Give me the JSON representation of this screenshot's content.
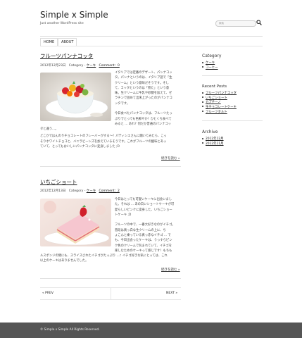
{
  "site": {
    "title": "Simple x Simple",
    "tagline": "Just another WordPress site"
  },
  "search": {
    "placeholder": "検索"
  },
  "nav": {
    "items": [
      "HOME",
      "ABOUT"
    ]
  },
  "posts": [
    {
      "title": "フルーツパンナコッタ",
      "date": "2012年12月23日",
      "category_label": "Category - ",
      "category": "ケーキ",
      "comment": "Comment : 0",
      "body_lines": [
        "イタリアでは定番のデザート、パンナコッ",
        "タ。パンナというのは、イタリア語で「生",
        "クリーム」という意味だそうです。そし",
        "て、コッタというのは「煮た」という意",
        "味。生クリームに牛乳や砂糖を加えて、ゼ",
        "ラチンで固めて出来上がったのがパンナコ",
        "ッタです。",
        "",
        "今日食べたパンナコッタは、フルーツたっ",
        "ぷりでとっても色鮮やか！ひとくち食べて",
        "みると ... あれ？何だか普通のパンナコッ"
      ],
      "body_after": [
        "タと違う...。",
        "どこかではんのりチョコレートのフレーバーがする～！パティシエさんに聞いてみたら、こっ",
        "そりホワイトチョコと、バニラビーンズを加えているそうです。これがフルーツの酸味とあっ",
        "ていて、とってもおいしいパンナコッタに変身しました ;D"
      ],
      "more": "続きを読む »"
    },
    {
      "title": "いちごショート",
      "date": "2012年12月13日",
      "category_label": "Category - ",
      "category": "ケーキ",
      "comment": "Comment : 2",
      "body_lines": [
        "今日はとっても可愛いケーキに出会いまし",
        "た。それは ... あの白いショートケーキが可",
        "愛らしいピンクに変身した、いちごショー",
        "トケーキ ;D",
        "",
        "フルーツの中で、一番大好きなのがイチゴ。",
        "普段は真っ白な生クリームの上に、ち",
        "ょこんと乗っている真っ赤なイチゴ ... で",
        "も、今日出会ったケーキは、うっすらピン",
        "ク色のクリームで包まれていて、イチゴを",
        "楽しむためのケーキって感じです！もちも"
      ],
      "body_after": [
        "ルスポンジの間にも、スライスされたイチゴがたっぷり ...♪ イチゴ好きな私にとっては、これ",
        "以上のケーキはありませんでした。"
      ],
      "more": "続きを読む »"
    }
  ],
  "pager": {
    "prev": "« PREV",
    "next": "NEXT »"
  },
  "sidebar": {
    "category_heading": "Category",
    "categories": [
      "ケーキ",
      "コーヒー"
    ],
    "recent_heading": "Recent Posts",
    "recent": [
      "フルーツパンナコッタ",
      "いちごショート",
      "カプチーノ",
      "生チョコレートケーキ",
      "フルーツタルト"
    ],
    "archive_heading": "Archive",
    "archives": [
      "2012年12月",
      "2012年11月"
    ]
  },
  "footer": {
    "text": "© Simple x Simple All Rights Reserved."
  },
  "colors": {
    "footer_bg": "#555555",
    "accent_red": "#d0202a"
  }
}
